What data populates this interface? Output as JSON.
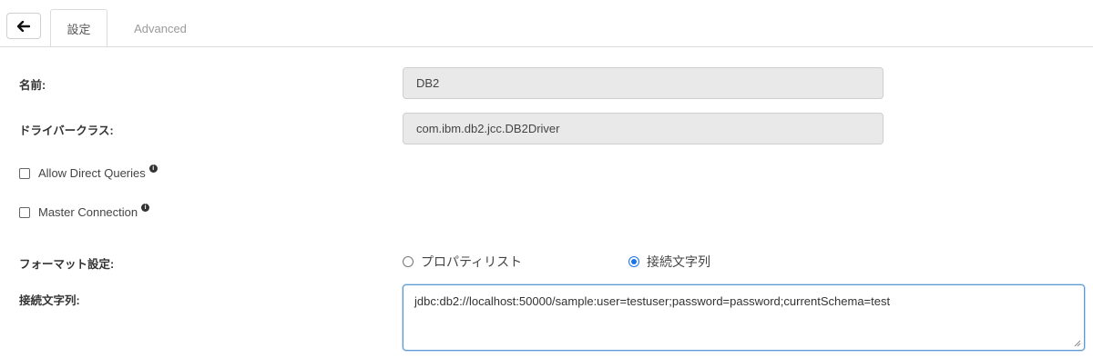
{
  "tabs": [
    {
      "label": "設定",
      "active": true
    },
    {
      "label": "Advanced",
      "active": false
    }
  ],
  "form": {
    "name_label": "名前:",
    "name_value": "DB2",
    "driver_label": "ドライバークラス:",
    "driver_value": "com.ibm.db2.jcc.DB2Driver",
    "allow_direct_label": "Allow Direct Queries",
    "allow_direct_checked": false,
    "master_conn_label": "Master Connection",
    "master_conn_checked": false,
    "format_label": "フォーマット設定:",
    "format_options": [
      {
        "label": "プロパティリスト",
        "selected": false
      },
      {
        "label": "接続文字列",
        "selected": true
      }
    ],
    "conn_label": "接続文字列:",
    "conn_value": "jdbc:db2://localhost:50000/sample:user=testuser;password=password;currentSchema=test"
  },
  "icons": {
    "back": "arrow-left-icon",
    "info": "info-icon",
    "resize": "resize-handle-icon"
  },
  "colors": {
    "accent": "#1a73e8",
    "focus_border": "#5b9bd5",
    "readonly_bg": "#e9e9e9"
  }
}
